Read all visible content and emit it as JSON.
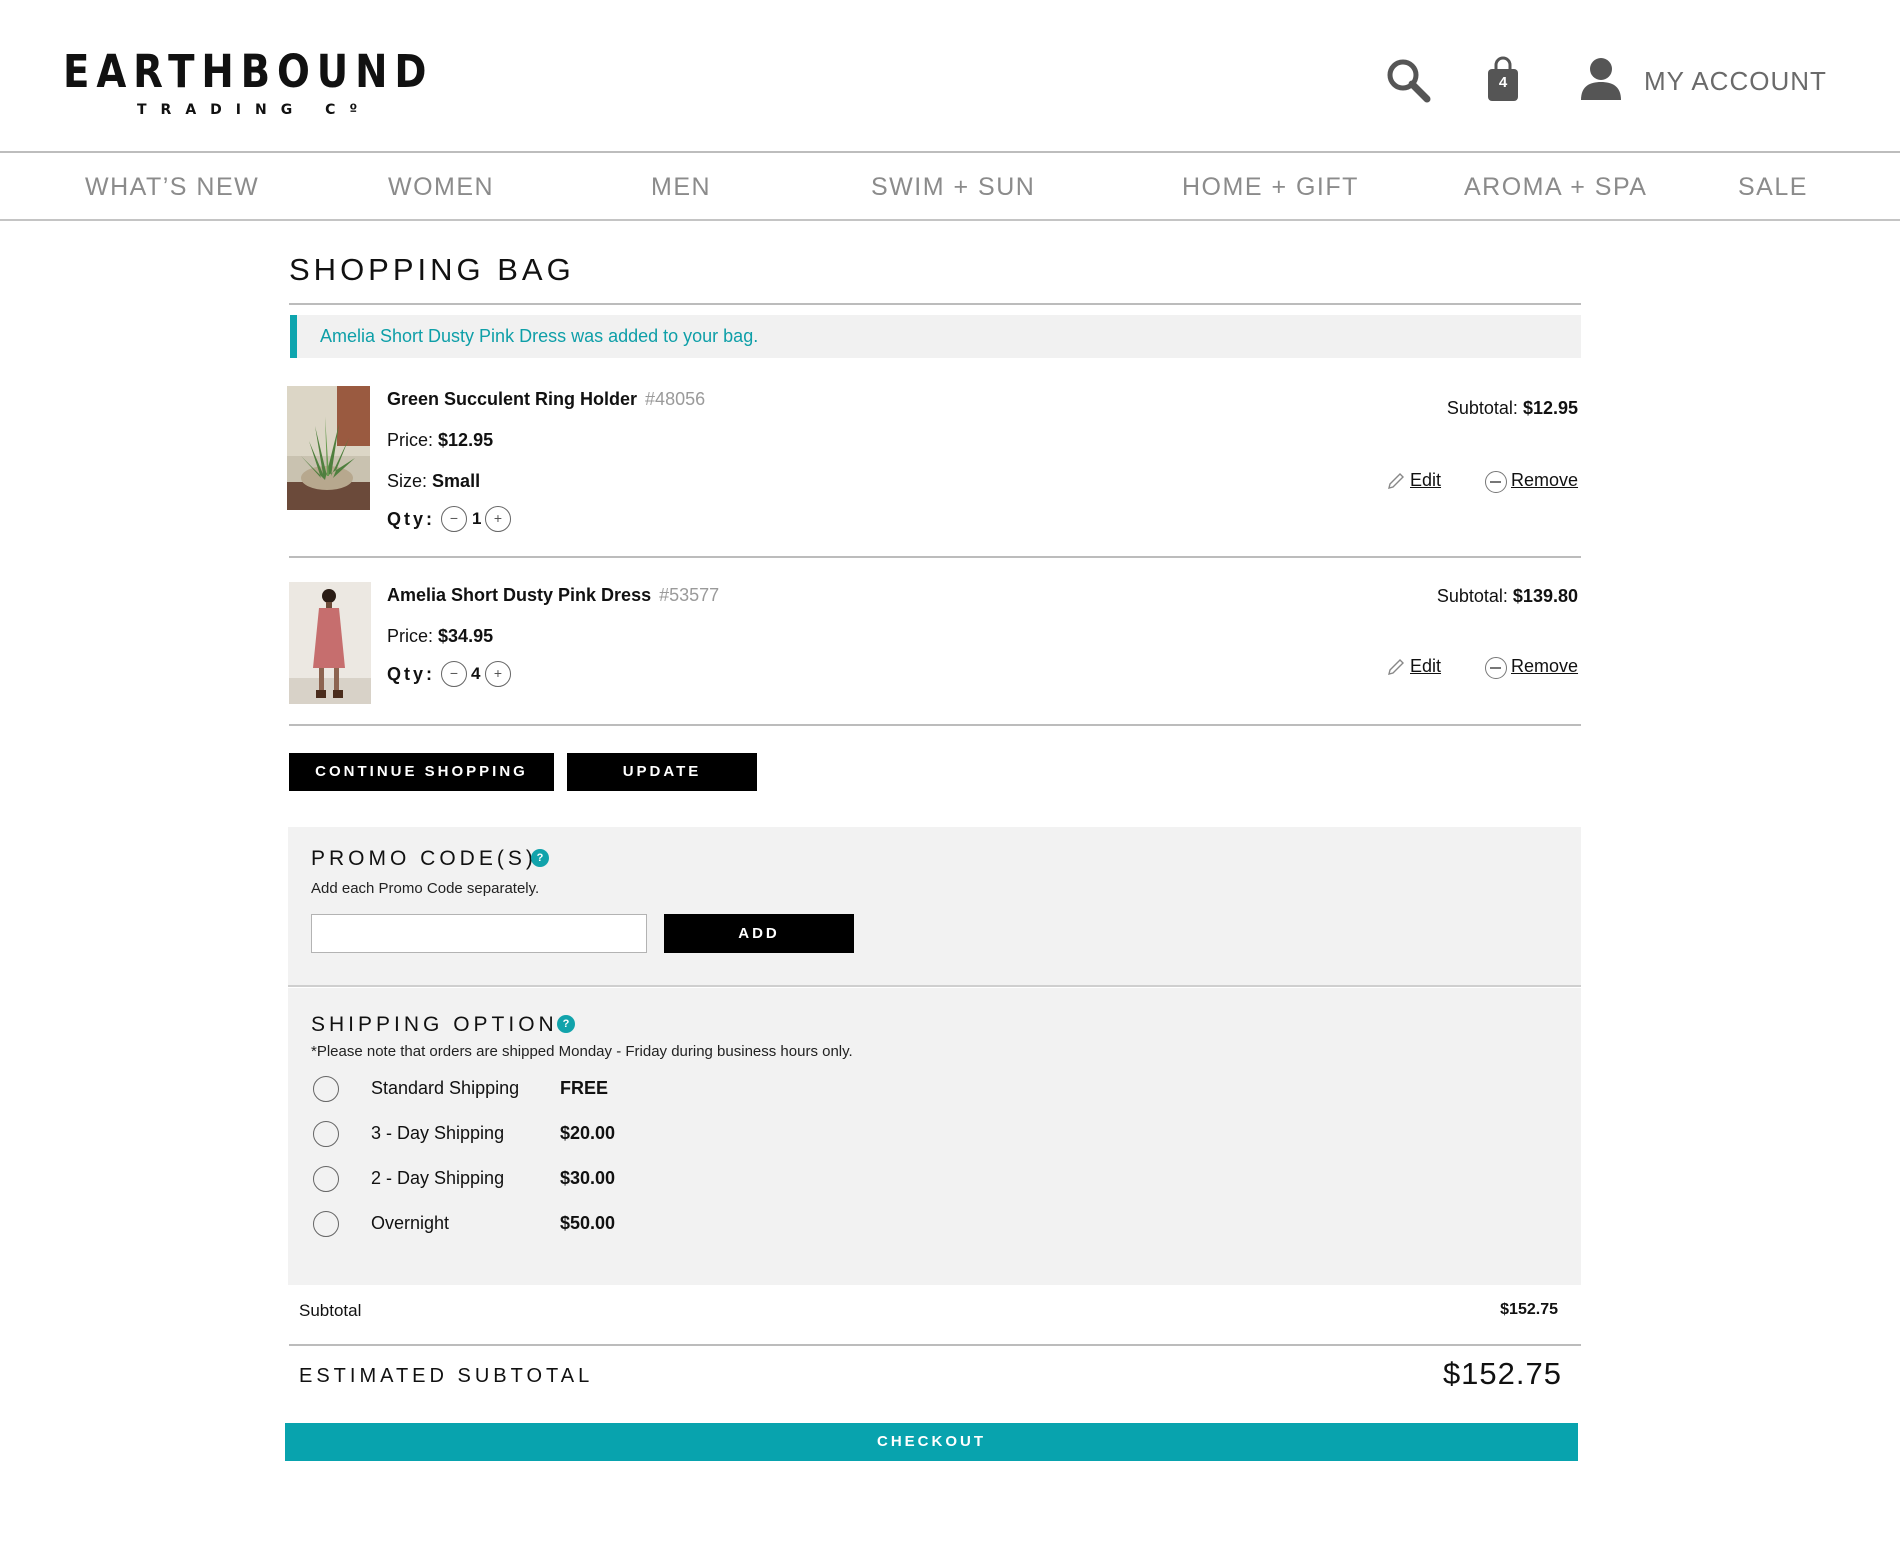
{
  "header": {
    "logo_main": "EARTHBOUND",
    "logo_sub": "TRADING Cº",
    "bag_count": "4",
    "account_label": "MY ACCOUNT"
  },
  "nav": [
    "WHAT’S NEW",
    "WOMEN",
    "MEN",
    "SWIM + SUN",
    "HOME + GIFT",
    "AROMA + SPA",
    "SALE"
  ],
  "page_title": "SHOPPING BAG",
  "notice": "Amelia Short Dusty Pink Dress was added to your bag.",
  "items": [
    {
      "name": "Green Succulent Ring Holder",
      "sku": "#48056",
      "price_label": "Price:",
      "price": "$12.95",
      "size_label": "Size:",
      "size": "Small",
      "qty_label": "Qty:",
      "qty": "1",
      "subtotal_label": "Subtotal:",
      "subtotal": "$12.95",
      "edit": "Edit",
      "remove": "Remove"
    },
    {
      "name": "Amelia Short Dusty Pink Dress",
      "sku": "#53577",
      "price_label": "Price:",
      "price": "$34.95",
      "qty_label": "Qty:",
      "qty": "4",
      "subtotal_label": "Subtotal:",
      "subtotal": "$139.80",
      "edit": "Edit",
      "remove": "Remove"
    }
  ],
  "buttons": {
    "continue": "CONTINUE SHOPPING",
    "update": "UPDATE",
    "add": "ADD",
    "checkout": "CHECKOUT"
  },
  "promo": {
    "title": "PROMO CODE(S)",
    "note": "Add each Promo Code separately.",
    "value": "",
    "placeholder": ""
  },
  "shipping": {
    "title": "SHIPPING OPTIONS",
    "note": "*Please note that orders are shipped Monday - Friday during business hours only.",
    "options": [
      {
        "name": "Standard Shipping",
        "price": "FREE"
      },
      {
        "name": "3 - Day Shipping",
        "price": "$20.00"
      },
      {
        "name": "2 - Day Shipping",
        "price": "$30.00"
      },
      {
        "name": "Overnight",
        "price": "$50.00"
      }
    ]
  },
  "summary": {
    "subtotal_label": "Subtotal",
    "subtotal_value": "$152.75",
    "estimated_label": "ESTIMATED SUBTOTAL",
    "estimated_value": "$152.75"
  },
  "colors": {
    "accent": "#08a3ae",
    "notice_text": "#0e9fa8",
    "nav_text": "#8b8b8b",
    "panel_bg": "#f2f2f2"
  }
}
